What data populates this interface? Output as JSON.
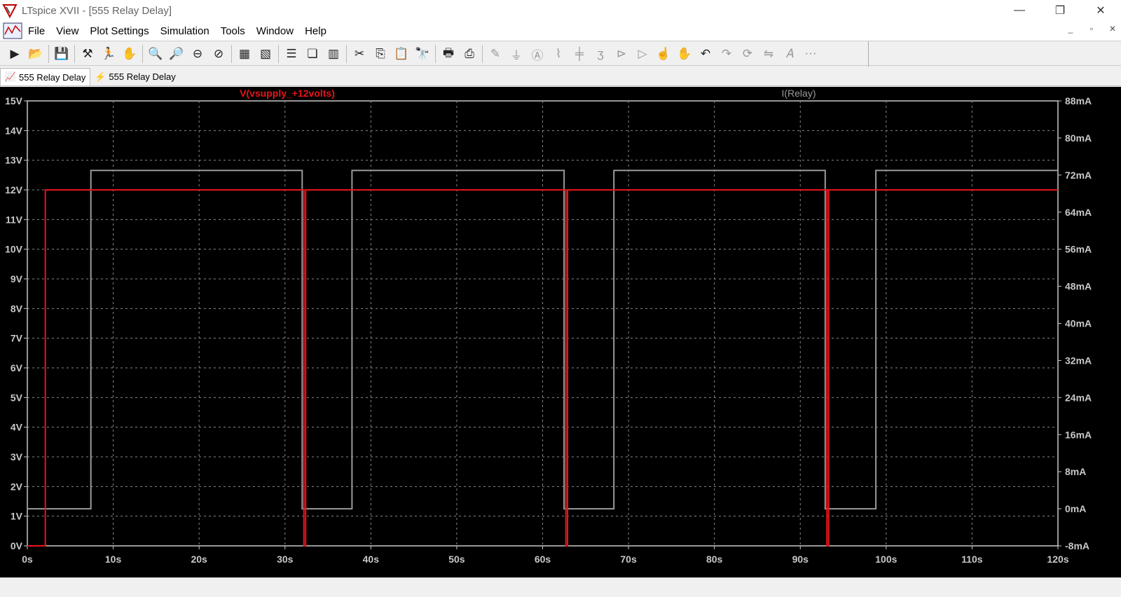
{
  "window": {
    "title": "LTspice XVII - [555 Relay Delay]",
    "minimize": "—",
    "restore": "❐",
    "close": "✕"
  },
  "menu": {
    "items": [
      "File",
      "View",
      "Plot Settings",
      "Simulation",
      "Tools",
      "Window",
      "Help"
    ],
    "mdi_minimize": "_",
    "mdi_restore": "▫",
    "mdi_close": "✕"
  },
  "toolbar": {
    "icons": [
      "run-icon",
      "open-icon",
      "save-icon",
      "control-panel-icon",
      "autoroute-icon",
      "pan-icon",
      "zoom-in-icon",
      "zoom-full-icon",
      "zoom-out-icon",
      "zoom-cancel-icon",
      "add-trace-icon",
      "auto-range-icon",
      "tile-horizontal-icon",
      "cascade-icon",
      "tile-vertical-icon",
      "cut-icon",
      "copy-icon",
      "paste-icon",
      "find-icon",
      "print-icon",
      "print-setup-icon",
      "wire-icon",
      "ground-icon",
      "label-icon",
      "resistor-icon",
      "capacitor-icon",
      "inductor-icon",
      "diode-icon",
      "component-icon",
      "move-icon",
      "drag-icon",
      "undo-icon",
      "redo-icon",
      "rotate-icon",
      "mirror-icon",
      "text-icon",
      "spice-directive-icon"
    ]
  },
  "tabs": [
    {
      "label": "555 Relay Delay",
      "active": true,
      "icon": "waveform-icon"
    },
    {
      "label": "555 Relay Delay",
      "active": false,
      "icon": "schematic-icon"
    }
  ],
  "colors": {
    "voltage_trace": "#e8141a",
    "current_trace": "#9a9a9a",
    "grid": "#8a8a8a",
    "axis_text": "#c8c8c8",
    "background": "#000000"
  },
  "chart_data": {
    "type": "line",
    "title": "",
    "xlabel": "",
    "ylabel_left": "",
    "ylabel_right": "",
    "xlim": [
      0,
      120
    ],
    "ylim_left": [
      0,
      15
    ],
    "ylim_right": [
      -8,
      88
    ],
    "x_ticks": [
      "0s",
      "10s",
      "20s",
      "30s",
      "40s",
      "50s",
      "60s",
      "70s",
      "80s",
      "90s",
      "100s",
      "110s",
      "120s"
    ],
    "y_left_ticks": [
      "0V",
      "1V",
      "2V",
      "3V",
      "4V",
      "5V",
      "6V",
      "7V",
      "8V",
      "9V",
      "10V",
      "11V",
      "12V",
      "13V",
      "14V",
      "15V"
    ],
    "y_right_ticks": [
      "-8mA",
      "0mA",
      "8mA",
      "16mA",
      "24mA",
      "32mA",
      "40mA",
      "48mA",
      "56mA",
      "64mA",
      "72mA",
      "80mA",
      "88mA"
    ],
    "grid": true,
    "series": [
      {
        "name": "V(vsupply_+12volts)",
        "axis": "left",
        "x": [
          0,
          2.1,
          2.1,
          32.2,
          32.2,
          32.4,
          32.4,
          62.7,
          62.7,
          62.9,
          62.9,
          93.1,
          93.1,
          93.3,
          93.3,
          120
        ],
        "y": [
          0,
          0,
          12,
          12,
          0,
          0,
          12,
          12,
          0,
          0,
          12,
          12,
          0,
          0,
          12,
          12
        ]
      },
      {
        "name": "I(Relay)",
        "axis": "right",
        "x": [
          0,
          7.4,
          7.4,
          32.0,
          32.0,
          37.8,
          37.8,
          62.5,
          62.5,
          68.3,
          68.3,
          92.9,
          92.9,
          98.8,
          98.8,
          120
        ],
        "y": [
          0,
          0,
          73,
          73,
          0,
          0,
          73,
          73,
          0,
          0,
          73,
          73,
          0,
          0,
          73,
          73
        ]
      }
    ]
  }
}
